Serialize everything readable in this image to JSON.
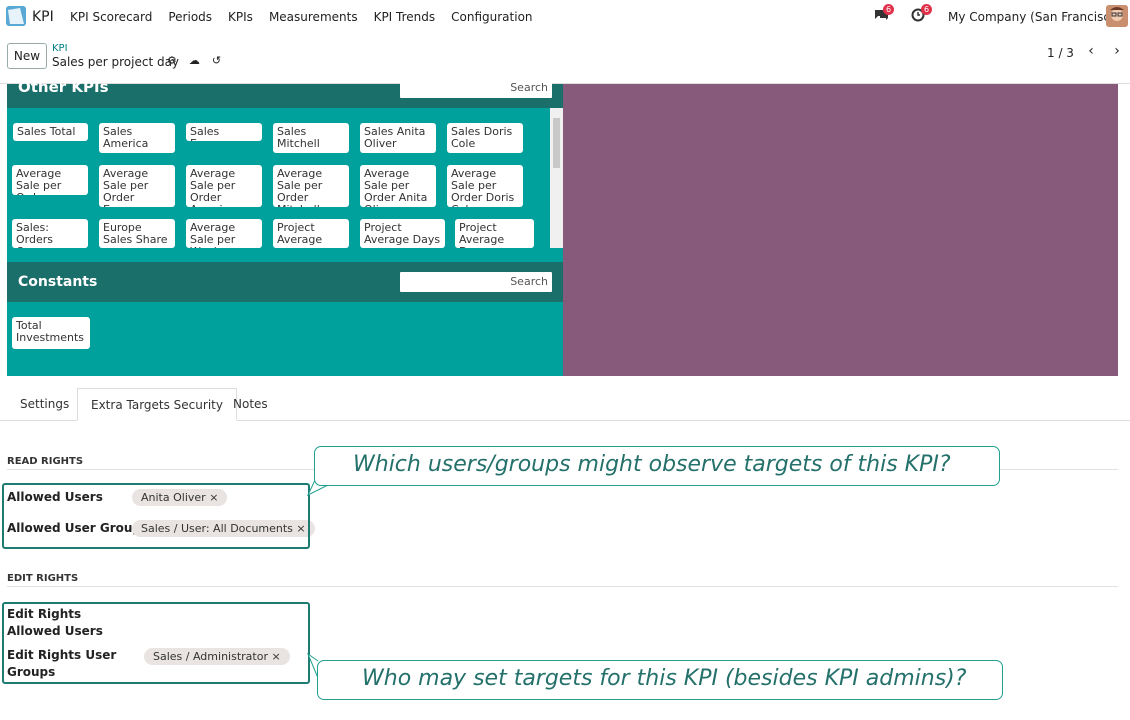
{
  "topbar": {
    "app_name": "KPI",
    "menu": [
      "KPI Scorecard",
      "Periods",
      "KPIs",
      "Measurements",
      "KPI Trends",
      "Configuration"
    ],
    "messages_count": "6",
    "activities_count": "6",
    "company": "My Company (San Francisco)"
  },
  "control": {
    "new_label": "New",
    "breadcrumb_parent": "KPI",
    "record_title": "Sales per project day",
    "pager": "1 / 3"
  },
  "other_kpis": {
    "title": "Other KPIs",
    "search_placeholder": "Search",
    "rows": [
      [
        "Sales Total",
        "Sales America",
        "Sales Europe",
        "Sales Mitchell",
        "Sales Anita Oliver",
        "Sales Doris Cole"
      ],
      [
        "Average Sale per Order",
        "Average Sale per Order Europe",
        "Average Sale per Order America",
        "Average Sale per Order Mitchell",
        "Average Sale per Order Anita Oliver",
        "Average Sale per Order Doris Cole"
      ],
      [
        "Sales: Orders Open",
        "Europe Sales Share",
        "Average Sale per Week",
        "Project Average",
        "Project Average Days",
        "Project Average Days"
      ]
    ]
  },
  "constants": {
    "title": "Constants",
    "search_placeholder": "Search",
    "items": [
      "Total Investments"
    ]
  },
  "tabs": [
    "Settings",
    "Extra Targets Security",
    "Notes"
  ],
  "read_rights": {
    "title": "READ RIGHTS",
    "allowed_users_label": "Allowed Users",
    "allowed_users": [
      "Anita Oliver"
    ],
    "allowed_groups_label": "Allowed User Groups",
    "allowed_groups": [
      "Sales / User: All Documents"
    ]
  },
  "edit_rights": {
    "title": "EDIT RIGHTS",
    "users_label": "Edit Rights Allowed Users",
    "groups_label": "Edit Rights User Groups",
    "groups": [
      "Sales / Administrator"
    ]
  },
  "callouts": {
    "read": "Which users/groups might observe targets of this KPI?",
    "edit": "Who may set targets for this KPI (besides KPI admins)?"
  },
  "colors": {
    "teal": "#00a09d",
    "dark_teal": "#1b6f6b",
    "purple": "#875a7b",
    "accent": "#017e84"
  }
}
